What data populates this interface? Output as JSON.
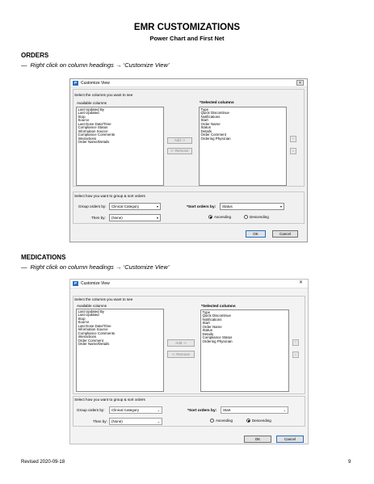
{
  "document": {
    "title": "EMR CUSTOMIZATIONS",
    "subtitle": "Power Chart and First Net",
    "footer_left": "Revised 2020-09-18",
    "page_number": "9"
  },
  "sections": [
    {
      "heading": "ORDERS",
      "dash": "—",
      "instruction": "Right click on column headings → ‘Customize View’",
      "dialog": {
        "app_icon": "P",
        "title": "Customize View",
        "select_columns_label": "Select the columns you want to see",
        "available_label": "Available columns",
        "available_items": [
          "Last Updated By",
          "Last Updated",
          "Stop",
          "Source",
          "Last Dose Date/Time",
          "Compliance Status",
          "Information Source",
          "Compliance Comments",
          "Interactions",
          "Order Name/Details"
        ],
        "selected_label": "*Selected columns",
        "selected_items": [
          "Type",
          "Quick Discontinue",
          "Notifications",
          "Start",
          "Order Name",
          "Status",
          "Details",
          "Order Comment",
          "Ordering Physician"
        ],
        "add_button": "Add ->",
        "remove_button": "<- Remove",
        "move_up_icon": "arrow-up-icon",
        "move_down_icon": "arrow-down-icon",
        "group_sort_label": "Select how you want to group & sort orders",
        "group_by_label": "Group orders by:",
        "group_by_value": "Clinical Category",
        "then_by_label": "Then by:",
        "then_by_value": "(None)",
        "sort_by_label": "*Sort orders by:",
        "sort_by_value": "Status",
        "ascending_label": "Ascending",
        "descending_label": "Descending",
        "selected_order": "Ascending",
        "ok_button": "OK",
        "cancel_button": "Cancel"
      }
    },
    {
      "heading": "MEDICATIONS",
      "dash": "—",
      "instruction": "Right click on column headings → ‘Customize View’",
      "dialog": {
        "app_icon": "P",
        "title": "Customize View",
        "select_columns_label": "Select the columns you want to see",
        "available_label": "Available columns",
        "available_items": [
          "Last Updated By",
          "Last Updated",
          "Stop",
          "Source",
          "Last Dose Date/Time",
          "Information Source",
          "Compliance Comments",
          "Interactions",
          "Order Comment",
          "Order Name/Details"
        ],
        "selected_label": "*Selected columns",
        "selected_items": [
          "Type",
          "Quick Discontinue",
          "Notifications",
          "Start",
          "Order Name",
          "Status",
          "Details",
          "Compliance Status",
          "Ordering Physician"
        ],
        "add_button": "Add ->",
        "remove_button": "<- Remove",
        "move_up_icon": "arrow-up-icon",
        "move_down_icon": "arrow-down-icon",
        "group_sort_label": "Select how you want to group & sort orders",
        "group_by_label": "Group orders by:",
        "group_by_value": "Clinical Category",
        "then_by_label": "Then by:",
        "then_by_value": "(None)",
        "sort_by_label": "*Sort orders by:",
        "sort_by_value": "Start",
        "ascending_label": "Ascending",
        "descending_label": "Descending",
        "selected_order": "Descending",
        "ok_button": "OK",
        "cancel_button": "Cancel"
      }
    }
  ]
}
